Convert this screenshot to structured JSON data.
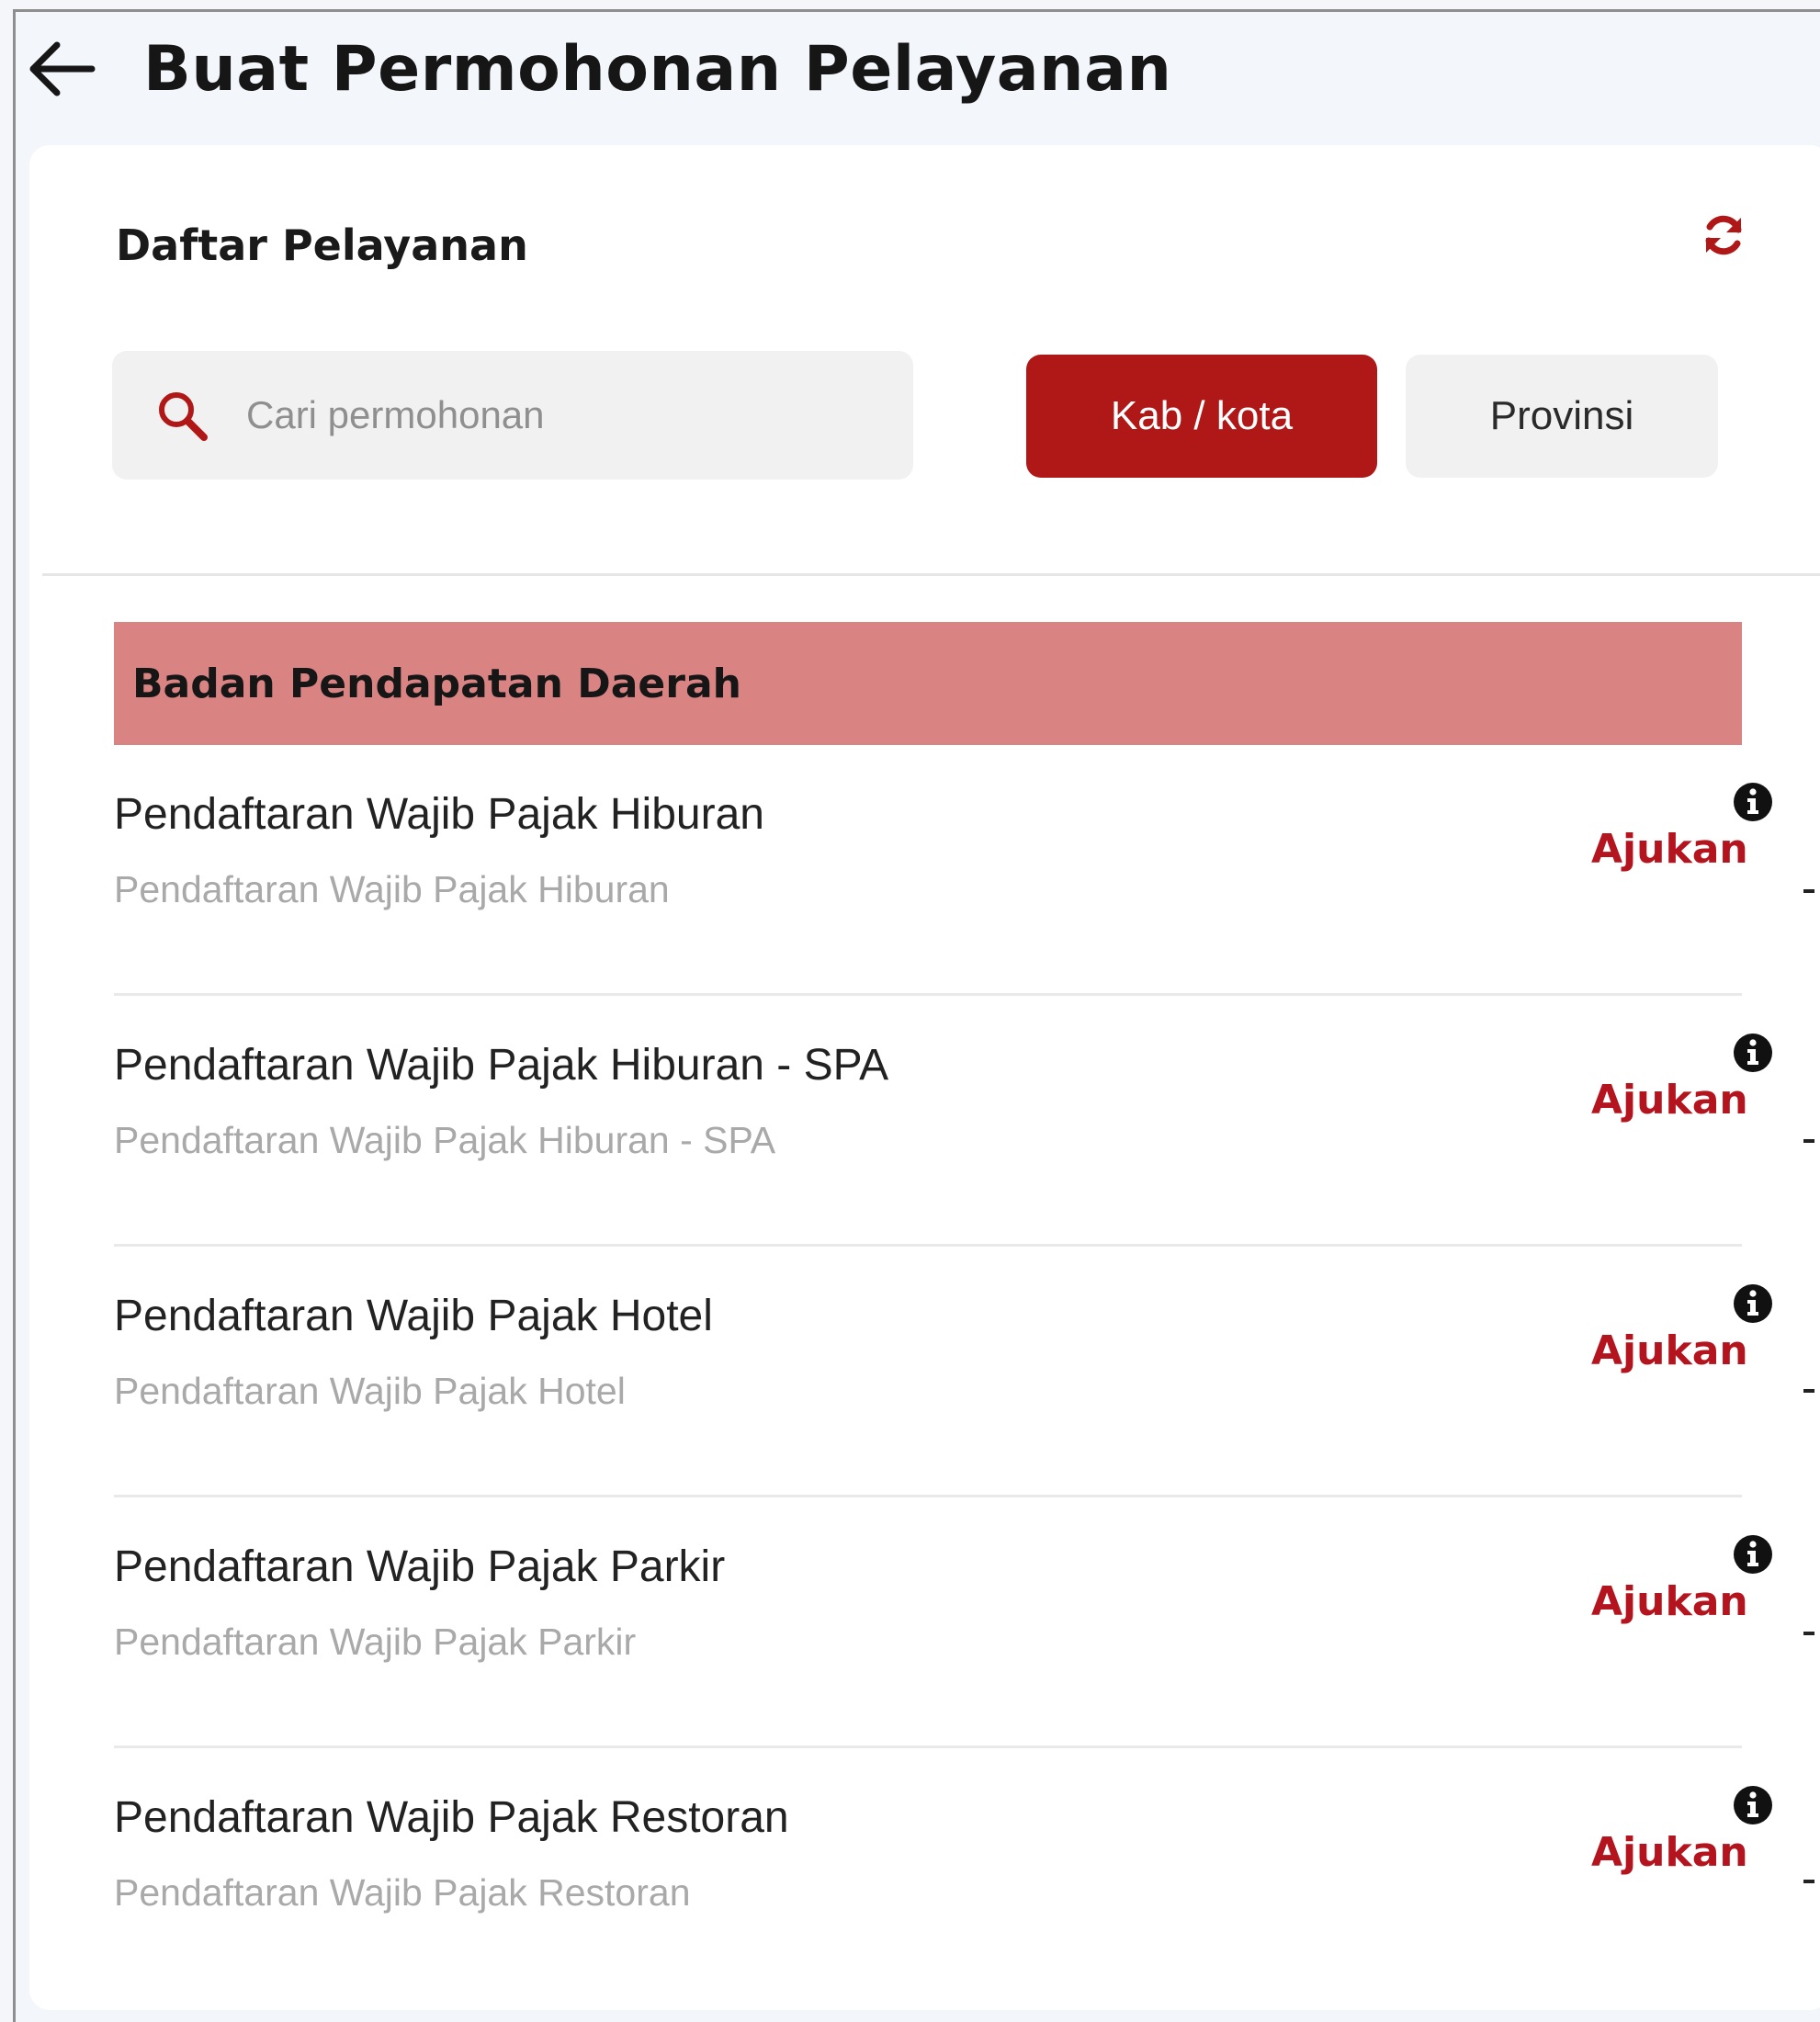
{
  "header": {
    "title": "Buat Permohonan Pelayanan",
    "back_icon": "arrow-left-icon"
  },
  "panel": {
    "section_title": "Daftar Pelayanan",
    "refresh_icon": "refresh-icon",
    "search": {
      "placeholder": "Cari permohonan",
      "value": "",
      "icon": "search-icon"
    },
    "filters": [
      {
        "label": "Kab / kota",
        "selected": true
      },
      {
        "label": "Provinsi",
        "selected": false
      }
    ]
  },
  "group": {
    "title": "Badan Pendapatan Daerah",
    "items": [
      {
        "title": "Pendaftaran Wajib Pajak Hiburan",
        "description": "Pendaftaran Wajib Pajak Hiburan",
        "action": "Ajukan"
      },
      {
        "title": "Pendaftaran Wajib Pajak Hiburan - SPA",
        "description": "Pendaftaran Wajib Pajak Hiburan - SPA",
        "action": "Ajukan"
      },
      {
        "title": "Pendaftaran Wajib Pajak Hotel",
        "description": "Pendaftaran Wajib Pajak Hotel",
        "action": "Ajukan"
      },
      {
        "title": "Pendaftaran Wajib Pajak Parkir",
        "description": "Pendaftaran Wajib Pajak Parkir",
        "action": "Ajukan"
      },
      {
        "title": "Pendaftaran Wajib Pajak Restoran",
        "description": "Pendaftaran Wajib Pajak Restoran",
        "action": "Ajukan"
      }
    ]
  },
  "colors": {
    "accent": "#b01818",
    "group_header": "#d98383",
    "action_text": "#b3141d"
  }
}
